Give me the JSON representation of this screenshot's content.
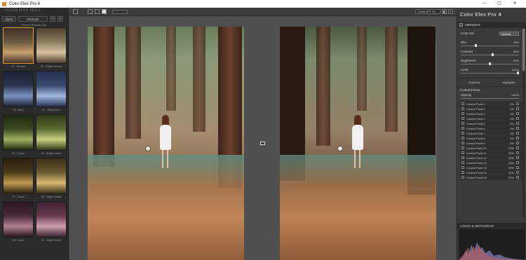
{
  "window": {
    "title": "Color Efex Pro 4",
    "minimize": "—",
    "maximize": "▢",
    "close": "✕"
  },
  "left": {
    "brand": "COLOR EFEX PRO 4",
    "back": "Back",
    "filter_name": "Midnight",
    "add": "+",
    "remove": "×",
    "results": "Search Results (10)",
    "presets": [
      {
        "label": "01 - Neutral",
        "c1": "#6a5a40",
        "c2": "#c8a070",
        "c3": "#40302a"
      },
      {
        "label": "02 - Bright Neutral",
        "c1": "#8a8060",
        "c2": "#d8c0a0",
        "c3": "#504030"
      },
      {
        "label": "03 - Blue",
        "c1": "#2a3450",
        "c2": "#7a90c0",
        "c3": "#1a2030"
      },
      {
        "label": "04 - Bright Blue",
        "c1": "#3a4a70",
        "c2": "#a0b8e0",
        "c3": "#253050"
      },
      {
        "label": "05 - Green",
        "c1": "#3a4a20",
        "c2": "#a0b060",
        "c3": "#202810"
      },
      {
        "label": "06 - Bright Green",
        "c1": "#5a6a30",
        "c2": "#c8d080",
        "c3": "#30381a"
      },
      {
        "label": "07 - Sepia",
        "c1": "#4a3a1a",
        "c2": "#c09a50",
        "c3": "#2a2010"
      },
      {
        "label": "08 - Bright Sepia",
        "c1": "#6a5a30",
        "c2": "#d8b870",
        "c3": "#3a3018"
      },
      {
        "label": "09 - Violet",
        "c1": "#4a2a3a",
        "c2": "#b08090",
        "c3": "#2a1820"
      },
      {
        "label": "10 - Bright Violet",
        "c1": "#6a3a50",
        "c2": "#d0a0b0",
        "c3": "#3a2030"
      }
    ]
  },
  "toolbar": {
    "zoom": "Zoom (FIT %)"
  },
  "right": {
    "brand": "Color Efex Pro",
    "version": "4",
    "filter": "MIDNIGHT",
    "color_set_label": "Color Set",
    "color_set_value": "Neutral",
    "sliders": [
      {
        "label": "Blur",
        "value": "25%",
        "pos": 0.25
      },
      {
        "label": "Contrast",
        "value": "55%",
        "pos": 0.55
      },
      {
        "label": "Brightness",
        "value": "50%",
        "pos": 0.5
      },
      {
        "label": "Color",
        "value": "100%",
        "pos": 1.0
      }
    ],
    "shadows": "Shadows",
    "highlights": "Highlights",
    "control_points": "Control Points",
    "opacity_label": "Opacity",
    "opacity_value": "100%",
    "points": [
      {
        "name": "Control Point 1",
        "pct": "0%"
      },
      {
        "name": "Control Point 2",
        "pct": "0%"
      },
      {
        "name": "Control Point 3",
        "pct": "0%"
      },
      {
        "name": "Control Point 4",
        "pct": "0%"
      },
      {
        "name": "Control Point 5",
        "pct": "0%"
      },
      {
        "name": "Control Point 6",
        "pct": "0%"
      },
      {
        "name": "Control Point 7",
        "pct": "0%"
      },
      {
        "name": "Control Point 8",
        "pct": "0%"
      },
      {
        "name": "Control Point 9",
        "pct": "0%"
      },
      {
        "name": "Control Point 10",
        "pct": "20%"
      },
      {
        "name": "Control Point 11",
        "pct": "20%"
      },
      {
        "name": "Control Point 12",
        "pct": "20%"
      },
      {
        "name": "Control Point 13",
        "pct": "20%"
      },
      {
        "name": "Control Point 14",
        "pct": "20%"
      },
      {
        "name": "Control Point 15",
        "pct": "20%"
      },
      {
        "name": "Control Point 16",
        "pct": "20%"
      }
    ],
    "loupe": "LOUPE & HISTOGRAM"
  },
  "colors": {
    "accent": "#e0a030",
    "panel": "#3a3a3a",
    "dark": "#2b2b2b"
  }
}
